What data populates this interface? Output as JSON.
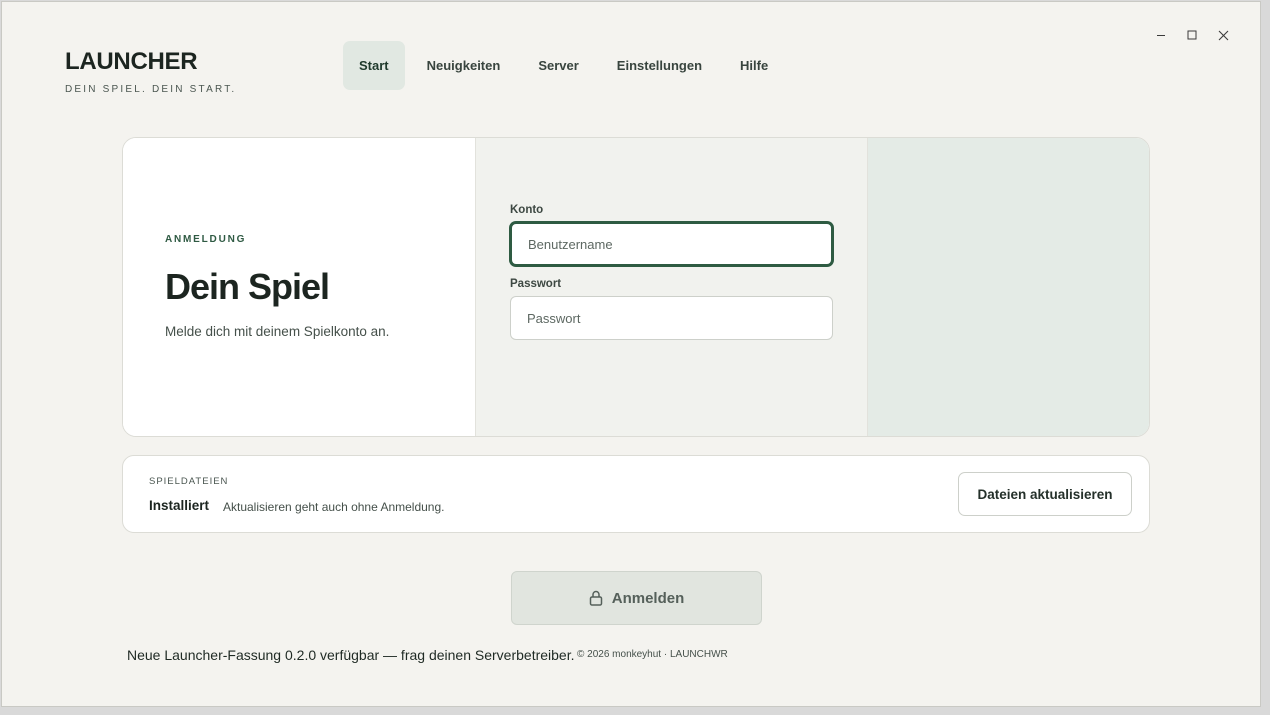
{
  "brand": {
    "title": "LAUNCHER",
    "subtitle": "DEIN SPIEL. DEIN START."
  },
  "window_controls": {
    "minimize_icon": "minimize-icon",
    "maximize_icon": "maximize-icon",
    "close_icon": "close-icon"
  },
  "nav": {
    "items": [
      {
        "label": "Start",
        "active": true
      },
      {
        "label": "Neuigkeiten",
        "active": false
      },
      {
        "label": "Server",
        "active": false
      },
      {
        "label": "Einstellungen",
        "active": false
      },
      {
        "label": "Hilfe",
        "active": false
      }
    ]
  },
  "login": {
    "eyebrow": "ANMELDUNG",
    "headline": "Dein Spiel",
    "lead": "Melde dich mit deinem Spielkonto an.",
    "account_label": "Konto",
    "account_placeholder": "Benutzername",
    "account_value": "",
    "password_label": "Passwort",
    "password_placeholder": "Passwort",
    "password_value": ""
  },
  "files": {
    "eyebrow": "SPIELDATEIEN",
    "status": "Installiert",
    "note": "Aktualisieren geht auch ohne Anmeldung.",
    "update_button": "Dateien aktualisieren"
  },
  "submit": {
    "label": "Anmelden",
    "icon": "lock-icon"
  },
  "footer": {
    "update_notice": "Neue Launcher-Fassung 0.2.0 verfügbar — frag deinen Serverbetreiber.",
    "copyright": "© 2026 monkeyhut · LAUNCHWR"
  },
  "colors": {
    "accent": "#2e5b42",
    "background": "#f4f3ef",
    "nav_active_bg": "#e1e8e2",
    "panel_right": "#e4ebe6"
  }
}
